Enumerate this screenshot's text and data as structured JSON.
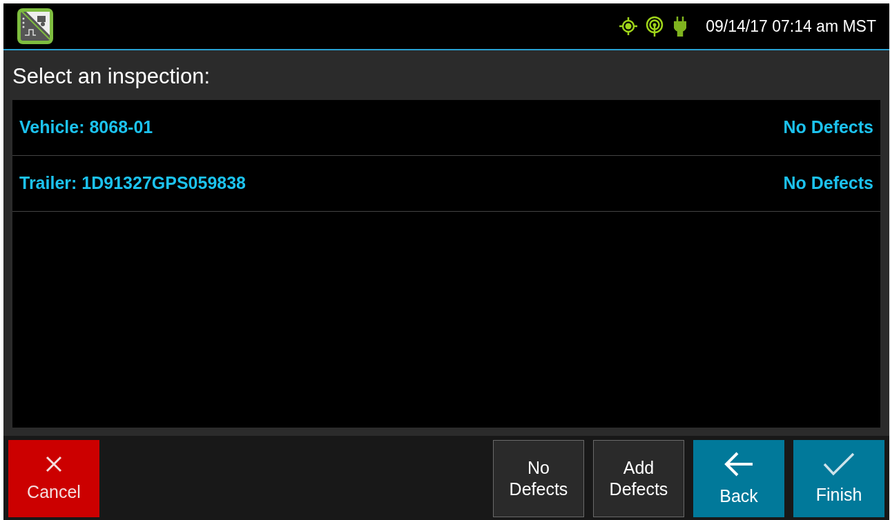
{
  "status_bar": {
    "datetime": "09/14/17 07:14 am MST"
  },
  "title": "Select an inspection:",
  "inspections": [
    {
      "label": "Vehicle: 8068-01",
      "status": "No Defects"
    },
    {
      "label": "Trailer: 1D91327GPS059838",
      "status": "No Defects"
    }
  ],
  "buttons": [
    {
      "kind": "cancel",
      "lines": [
        "Cancel"
      ]
    },
    {
      "kind": "text",
      "lines": [
        "No",
        "Defects"
      ]
    },
    {
      "kind": "text",
      "lines": [
        "Add",
        "Defects"
      ]
    },
    {
      "kind": "back",
      "lines": [
        "Back"
      ]
    },
    {
      "kind": "finish",
      "lines": [
        "Finish"
      ]
    }
  ]
}
